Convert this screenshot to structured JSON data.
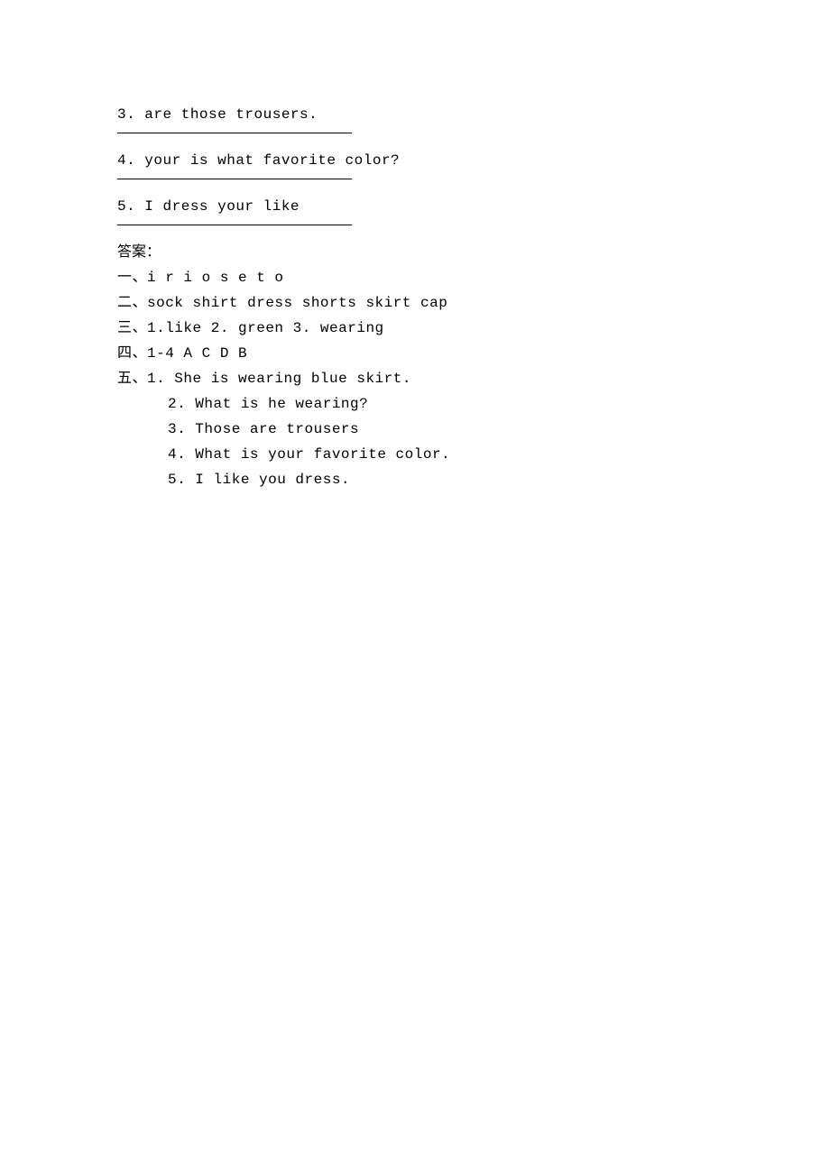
{
  "questions": {
    "q3": "3. are those trousers.",
    "q4": "4. your is what favorite color?",
    "q5": "5. I dress your like"
  },
  "answers": {
    "header": "答案：",
    "line1": "一、i r i o s e t o",
    "line2": "二、sock  shirt  dress  shorts  skirt  cap",
    "line3": "三、1.like  2. green  3. wearing",
    "line4": "四、1-4 A C D B",
    "line5_main": "五、1. She is wearing blue skirt.",
    "line5_2": "2. What is he wearing?",
    "line5_3": "3. Those are trousers",
    "line5_4": "4. What is your favorite color.",
    "line5_5": "5. I like you dress."
  }
}
